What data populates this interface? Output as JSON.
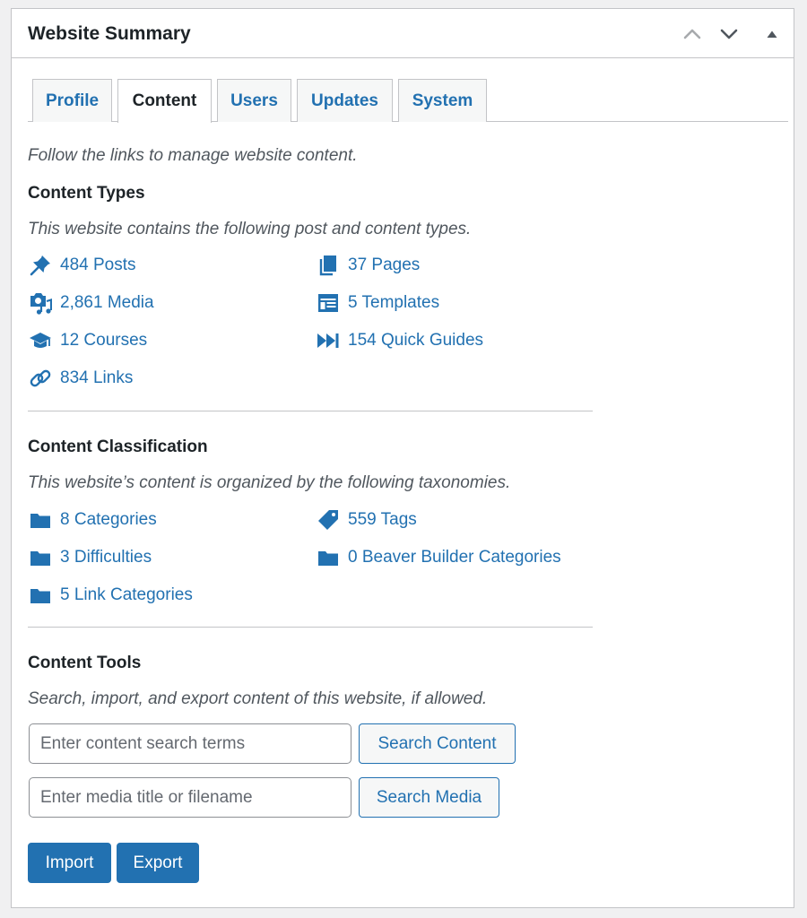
{
  "panel": {
    "title": "Website Summary",
    "controls": [
      "chevron-up-icon",
      "chevron-down-icon",
      "triangle-up-icon"
    ]
  },
  "tabs": [
    {
      "label": "Profile",
      "active": false
    },
    {
      "label": "Content",
      "active": true
    },
    {
      "label": "Users",
      "active": false
    },
    {
      "label": "Updates",
      "active": false
    },
    {
      "label": "System",
      "active": false
    }
  ],
  "intro": "Follow the links to manage website content.",
  "content_types": {
    "title": "Content Types",
    "description": "This website contains the following post and content types.",
    "items": [
      {
        "label": "484 Posts",
        "icon": "pushpin-icon"
      },
      {
        "label": "37 Pages",
        "icon": "pages-icon"
      },
      {
        "label": "2,861 Media",
        "icon": "media-icon"
      },
      {
        "label": "5 Templates",
        "icon": "templates-icon"
      },
      {
        "label": "12 Courses",
        "icon": "graduation-cap-icon"
      },
      {
        "label": "154 Quick Guides",
        "icon": "fast-forward-icon"
      },
      {
        "label": "834 Links",
        "icon": "link-icon"
      }
    ]
  },
  "content_classification": {
    "title": "Content Classification",
    "description": "This website’s content is organized by the following taxonomies.",
    "items": [
      {
        "label": "8 Categories",
        "icon": "folder-icon"
      },
      {
        "label": "559 Tags",
        "icon": "tag-icon"
      },
      {
        "label": "3 Difficulties",
        "icon": "folder-icon"
      },
      {
        "label": "0 Beaver Builder Categories",
        "icon": "folder-icon"
      },
      {
        "label": "5 Link Categories",
        "icon": "folder-icon"
      }
    ]
  },
  "content_tools": {
    "title": "Content Tools",
    "description": "Search, import, and export content of this website, if allowed.",
    "search_content": {
      "placeholder": "Enter content search terms",
      "value": "",
      "button": "Search Content"
    },
    "search_media": {
      "placeholder": "Enter media title or filename",
      "value": "",
      "button": "Search Media"
    },
    "import_label": "Import",
    "export_label": "Export"
  },
  "colors": {
    "link": "#2271b1",
    "primary_button": "#2271b1",
    "border": "#c3c4c7",
    "background": "#f0f0f1"
  }
}
